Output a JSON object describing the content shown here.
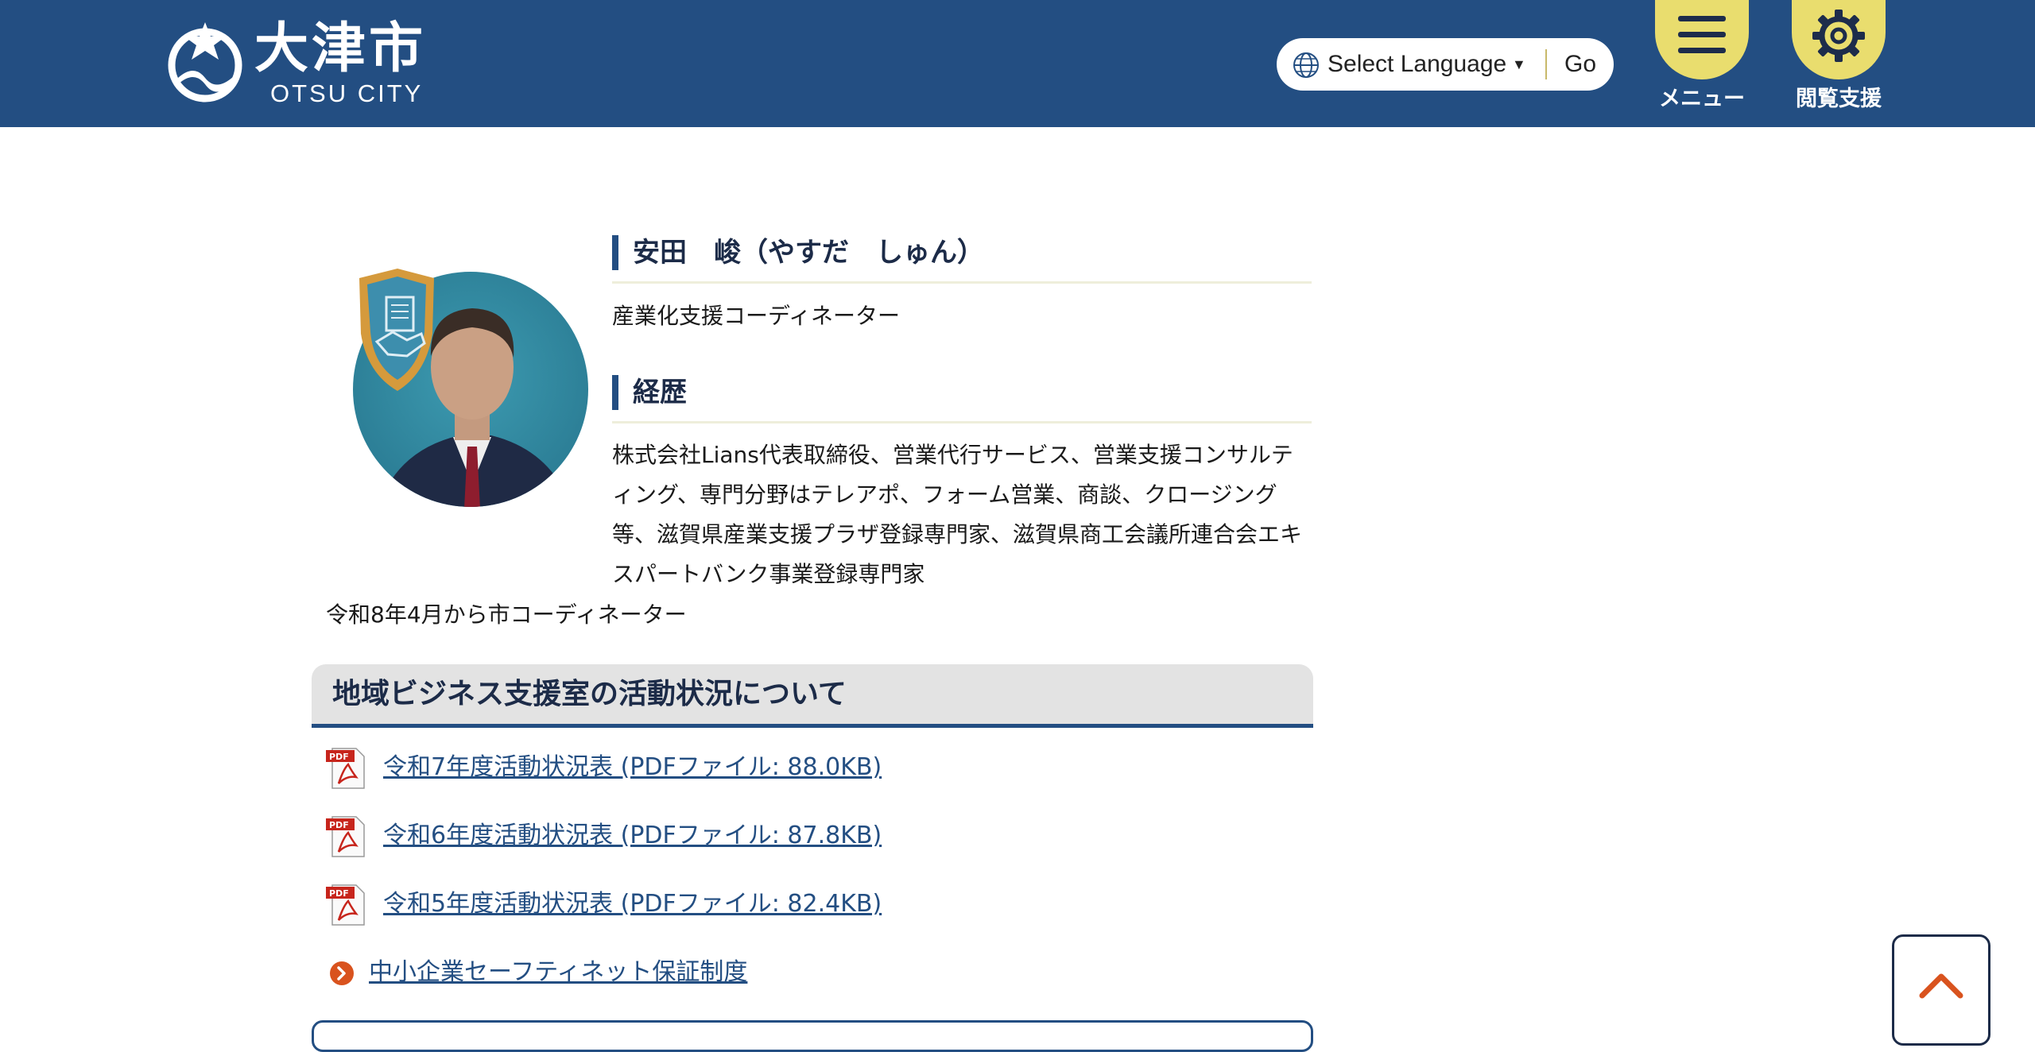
{
  "header": {
    "logo_kanji": "大津市",
    "logo_en": "OTSU CITY",
    "language_label": "Select Language",
    "language_caret": "▼",
    "go_label": "Go",
    "menu_label": "メニュー",
    "access_label": "閲覧支援",
    "colors": {
      "header_bg": "#234e82",
      "button_yellow": "#e9dd6e"
    }
  },
  "profile": {
    "photo_icon": "coordinator-portrait-with-shield-badge",
    "name_heading": "安田　峻（やすだ　しゅん）",
    "role": "産業化支援コーディネーター",
    "career_heading": "経歴",
    "career_text": "株式会社Lians代表取締役、営業代行サービス、営業支援コンサルティング、専門分野はテレアポ、フォーム営業、商談、クロージング等、滋賀県産業支援プラザ登録専門家、滋賀県商工会議所連合会エキスパートバンク事業登録専門家",
    "note": "令和8年4月から市コーディネーター"
  },
  "activity": {
    "heading": "地域ビジネス支援室の活動状況について",
    "files": [
      {
        "label": "令和7年度活動状況表 (PDFファイル: 88.0KB)",
        "icon": "pdf-icon"
      },
      {
        "label": "令和6年度活動状況表 (PDFファイル: 87.8KB)",
        "icon": "pdf-icon"
      },
      {
        "label": "令和5年度活動状況表 (PDFファイル: 82.4KB)",
        "icon": "pdf-icon"
      }
    ],
    "related_link": {
      "label": "中小企業セーフティネット保証制度",
      "icon": "arrow-circle-icon"
    }
  },
  "page_top_icon": "chevron-up-icon"
}
